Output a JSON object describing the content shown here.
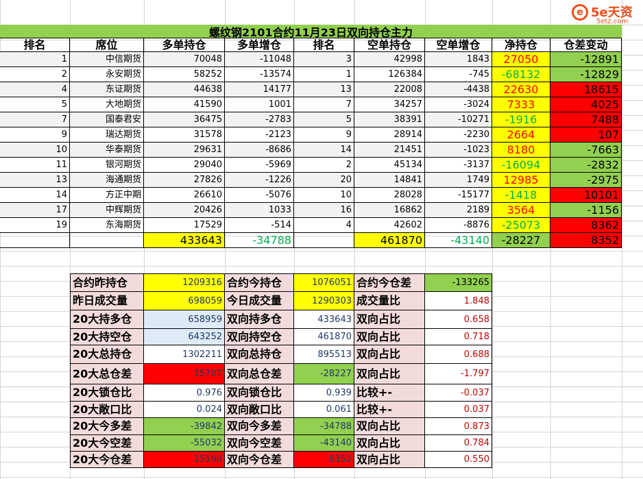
{
  "logo": {
    "mark": "e",
    "brand": "5e天资",
    "sub": "5etz.com"
  },
  "title": "螺纹钢2101合约11月23日双向持仓主力",
  "colors": {
    "green": "#92d050",
    "yellow": "#ffff00",
    "red": "#ff0000",
    "pink": "#f2dcdb",
    "lightblue": "#ddebf7",
    "gray": "#f2f2f2"
  },
  "headers": [
    "排名",
    "席位",
    "多单持仓",
    "多单增仓",
    "排名",
    "空单持仓",
    "空单增仓",
    "净持仓",
    "仓差变动"
  ],
  "rows": [
    {
      "rank": "1",
      "seat": "中信期货",
      "long": "70048",
      "long_chg": "-11048",
      "srank": "3",
      "short": "42998",
      "short_chg": "1843",
      "net": "27050",
      "net_c": "red",
      "diff": "-12891",
      "diff_c": "green"
    },
    {
      "rank": "2",
      "seat": "永安期货",
      "long": "58252",
      "long_chg": "-13574",
      "srank": "1",
      "short": "126384",
      "short_chg": "-745",
      "net": "-68132",
      "net_c": "green",
      "diff": "-12829",
      "diff_c": "green"
    },
    {
      "rank": "4",
      "seat": "东证期货",
      "long": "44638",
      "long_chg": "14177",
      "srank": "13",
      "short": "22008",
      "short_chg": "-4438",
      "net": "22630",
      "net_c": "red",
      "diff": "18615",
      "diff_c": "red"
    },
    {
      "rank": "5",
      "seat": "大地期货",
      "long": "41590",
      "long_chg": "1001",
      "srank": "7",
      "short": "34257",
      "short_chg": "-3024",
      "net": "7333",
      "net_c": "red",
      "diff": "4025",
      "diff_c": "red"
    },
    {
      "rank": "7",
      "seat": "国泰君安",
      "long": "36475",
      "long_chg": "-2783",
      "srank": "5",
      "short": "38391",
      "short_chg": "-10271",
      "net": "-1916",
      "net_c": "green",
      "diff": "7488",
      "diff_c": "red"
    },
    {
      "rank": "9",
      "seat": "瑞达期货",
      "long": "31578",
      "long_chg": "-2123",
      "srank": "9",
      "short": "28914",
      "short_chg": "-2230",
      "net": "2664",
      "net_c": "red",
      "diff": "107",
      "diff_c": "red"
    },
    {
      "rank": "10",
      "seat": "华泰期货",
      "long": "29631",
      "long_chg": "-8686",
      "srank": "14",
      "short": "21451",
      "short_chg": "-1023",
      "net": "8180",
      "net_c": "red",
      "diff": "-7663",
      "diff_c": "green"
    },
    {
      "rank": "11",
      "seat": "银河期货",
      "long": "29040",
      "long_chg": "-5969",
      "srank": "2",
      "short": "45134",
      "short_chg": "-3137",
      "net": "-16094",
      "net_c": "green",
      "diff": "-2832",
      "diff_c": "green"
    },
    {
      "rank": "13",
      "seat": "海通期货",
      "long": "27826",
      "long_chg": "-1226",
      "srank": "20",
      "short": "14841",
      "short_chg": "1749",
      "net": "12985",
      "net_c": "red",
      "diff": "-2975",
      "diff_c": "green"
    },
    {
      "rank": "14",
      "seat": "方正中期",
      "long": "26610",
      "long_chg": "-5076",
      "srank": "10",
      "short": "28028",
      "short_chg": "-15177",
      "net": "-1418",
      "net_c": "green",
      "diff": "10101",
      "diff_c": "red"
    },
    {
      "rank": "17",
      "seat": "中辉期货",
      "long": "20426",
      "long_chg": "1033",
      "srank": "16",
      "short": "16862",
      "short_chg": "2189",
      "net": "3564",
      "net_c": "red",
      "diff": "-1156",
      "diff_c": "green"
    },
    {
      "rank": "19",
      "seat": "东海期货",
      "long": "17529",
      "long_chg": "-514",
      "srank": "4",
      "short": "42602",
      "short_chg": "-8876",
      "net": "-25073",
      "net_c": "green",
      "diff": "8362",
      "diff_c": "red"
    }
  ],
  "totals": {
    "long": "433643",
    "long_chg": "-34788",
    "short": "461870",
    "short_chg": "-43140",
    "net": "-28227",
    "diff": "8352"
  },
  "summary": [
    {
      "l1": "合约昨持仓",
      "v1": "1209316",
      "b1": "yellow",
      "l2": "合约今持仓",
      "v2": "1076051",
      "b2": "yellow",
      "l3": "合约今仓差",
      "v3": "-133265",
      "b3": "green",
      "c3": "#000"
    },
    {
      "l1": "昨日成交量",
      "v1": "698059",
      "b1": "yellow",
      "l2": "今日成交量",
      "v2": "1290303",
      "b2": "yellow",
      "l3": "成交量比",
      "v3": "1.848",
      "b3": "white",
      "c3": "#c00000"
    },
    {
      "l1": "20大持多仓",
      "v1": "658959",
      "b1": "lightblue",
      "l2": "双向持多仓",
      "v2": "433643",
      "b2": "white",
      "l3": "双向占比",
      "v3": "0.658",
      "b3": "white",
      "c3": "#c00000"
    },
    {
      "l1": "20大持空仓",
      "v1": "643252",
      "b1": "lightblue",
      "l2": "双向持空仓",
      "v2": "461870",
      "b2": "white",
      "l3": "双向占比",
      "v3": "0.718",
      "b3": "white",
      "c3": "#c00000"
    },
    {
      "l1": "20大总持仓",
      "v1": "1302211",
      "b1": "white",
      "l2": "双向总持仓",
      "v2": "895513",
      "b2": "white",
      "l3": "双向占比",
      "v3": "0.688",
      "b3": "white",
      "c3": "#c00000"
    },
    {
      "l1": "20大总仓差",
      "v1": "15707",
      "b1": "red",
      "l2": "双向总仓差",
      "v2": "-28227",
      "b2": "green",
      "l3": "双向占比",
      "v3": "-1.797",
      "b3": "white",
      "c3": "#c00000"
    },
    {
      "l1": "20大锁仓比",
      "v1": "0.976",
      "b1": "white",
      "l2": "双向锁仓比",
      "v2": "0.939",
      "b2": "white",
      "l3": "比较+-",
      "v3": "-0.037",
      "b3": "white",
      "c3": "#c00000"
    },
    {
      "l1": "20大敞口比",
      "v1": "0.024",
      "b1": "white",
      "l2": "双向敞口比",
      "v2": "0.061",
      "b2": "white",
      "l3": "比较+-",
      "v3": "0.037",
      "b3": "white",
      "c3": "#c00000"
    },
    {
      "l1": "20大今多差",
      "v1": "-39842",
      "b1": "green",
      "l2": "双向今多差",
      "v2": "-34788",
      "b2": "green",
      "l3": "双向占比",
      "v3": "0.873",
      "b3": "white",
      "c3": "#c00000"
    },
    {
      "l1": "20大今空差",
      "v1": "-55032",
      "b1": "green",
      "l2": "双向今空差",
      "v2": "-43140",
      "b2": "green",
      "l3": "双向占比",
      "v3": "0.784",
      "b3": "white",
      "c3": "#c00000"
    },
    {
      "l1": "20大今仓差",
      "v1": "15190",
      "b1": "red",
      "l2": "双向今仓差",
      "v2": "8352",
      "b2": "red",
      "l3": "双向占比",
      "v3": "0.550",
      "b3": "white",
      "c3": "#c00000"
    }
  ]
}
